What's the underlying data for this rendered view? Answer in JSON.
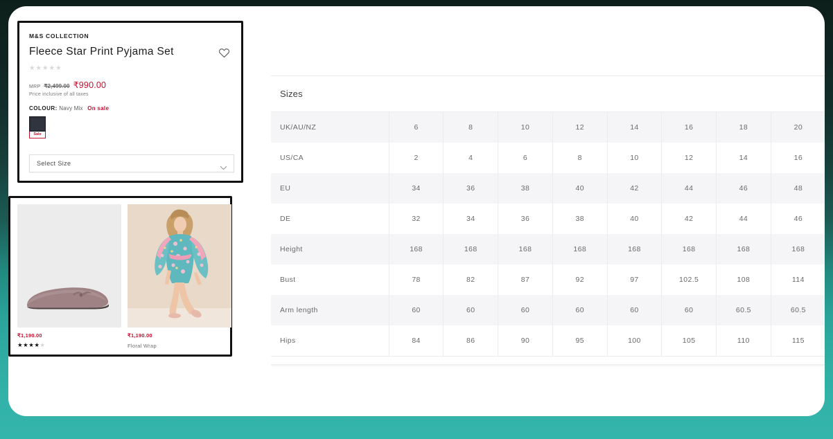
{
  "theme": {
    "background_top": "#0d1f1a",
    "background_bottom": "#34b5ab",
    "accent_red": "#c8102e",
    "panel_bg": "#ffffff"
  },
  "product": {
    "brand": "M&S COLLECTION",
    "title": "Fleece Star Print Pyjama Set",
    "rating_stars_empty": "★★★★★",
    "wishlist_icon": "heart-icon",
    "price": {
      "mrp_label": "MRP",
      "mrp_value": "₹2,499.00",
      "sale_value": "₹990.00",
      "tax_note": "Price inclusive of all taxes"
    },
    "colour": {
      "label": "COLOUR:",
      "value": "Navy Mix",
      "badge": "On sale",
      "swatch_hex": "#30343f",
      "swatch_tag": "Sale"
    },
    "size_select": {
      "placeholder": "Select Size",
      "chevron_icon": "chevron-down-icon"
    }
  },
  "recommendations": [
    {
      "price": "₹1,190.00",
      "stars_filled": "★★★★",
      "stars_empty": "★",
      "name": "",
      "image_alt": "ballet-flat-shoe"
    },
    {
      "price": "₹1,190.00",
      "stars_filled": "",
      "stars_empty": "",
      "name": "Floral Wrap",
      "image_alt": "model-in-floral-wrap"
    }
  ],
  "sizes_table": {
    "title": "Sizes",
    "rows": [
      {
        "label": "UK/AU/NZ",
        "values": [
          "6",
          "8",
          "10",
          "12",
          "14",
          "16",
          "18",
          "20"
        ]
      },
      {
        "label": "US/CA",
        "values": [
          "2",
          "4",
          "6",
          "8",
          "10",
          "12",
          "14",
          "16"
        ]
      },
      {
        "label": "EU",
        "values": [
          "34",
          "36",
          "38",
          "40",
          "42",
          "44",
          "46",
          "48"
        ]
      },
      {
        "label": "DE",
        "values": [
          "32",
          "34",
          "36",
          "38",
          "40",
          "42",
          "44",
          "46"
        ]
      },
      {
        "label": "Height",
        "values": [
          "168",
          "168",
          "168",
          "168",
          "168",
          "168",
          "168",
          "168"
        ]
      },
      {
        "label": "Bust",
        "values": [
          "78",
          "82",
          "87",
          "92",
          "97",
          "102.5",
          "108",
          "114"
        ]
      },
      {
        "label": "Arm length",
        "values": [
          "60",
          "60",
          "60",
          "60",
          "60",
          "60",
          "60.5",
          "60.5"
        ]
      },
      {
        "label": "Hips",
        "values": [
          "84",
          "86",
          "90",
          "95",
          "100",
          "105",
          "110",
          "115"
        ]
      }
    ]
  }
}
